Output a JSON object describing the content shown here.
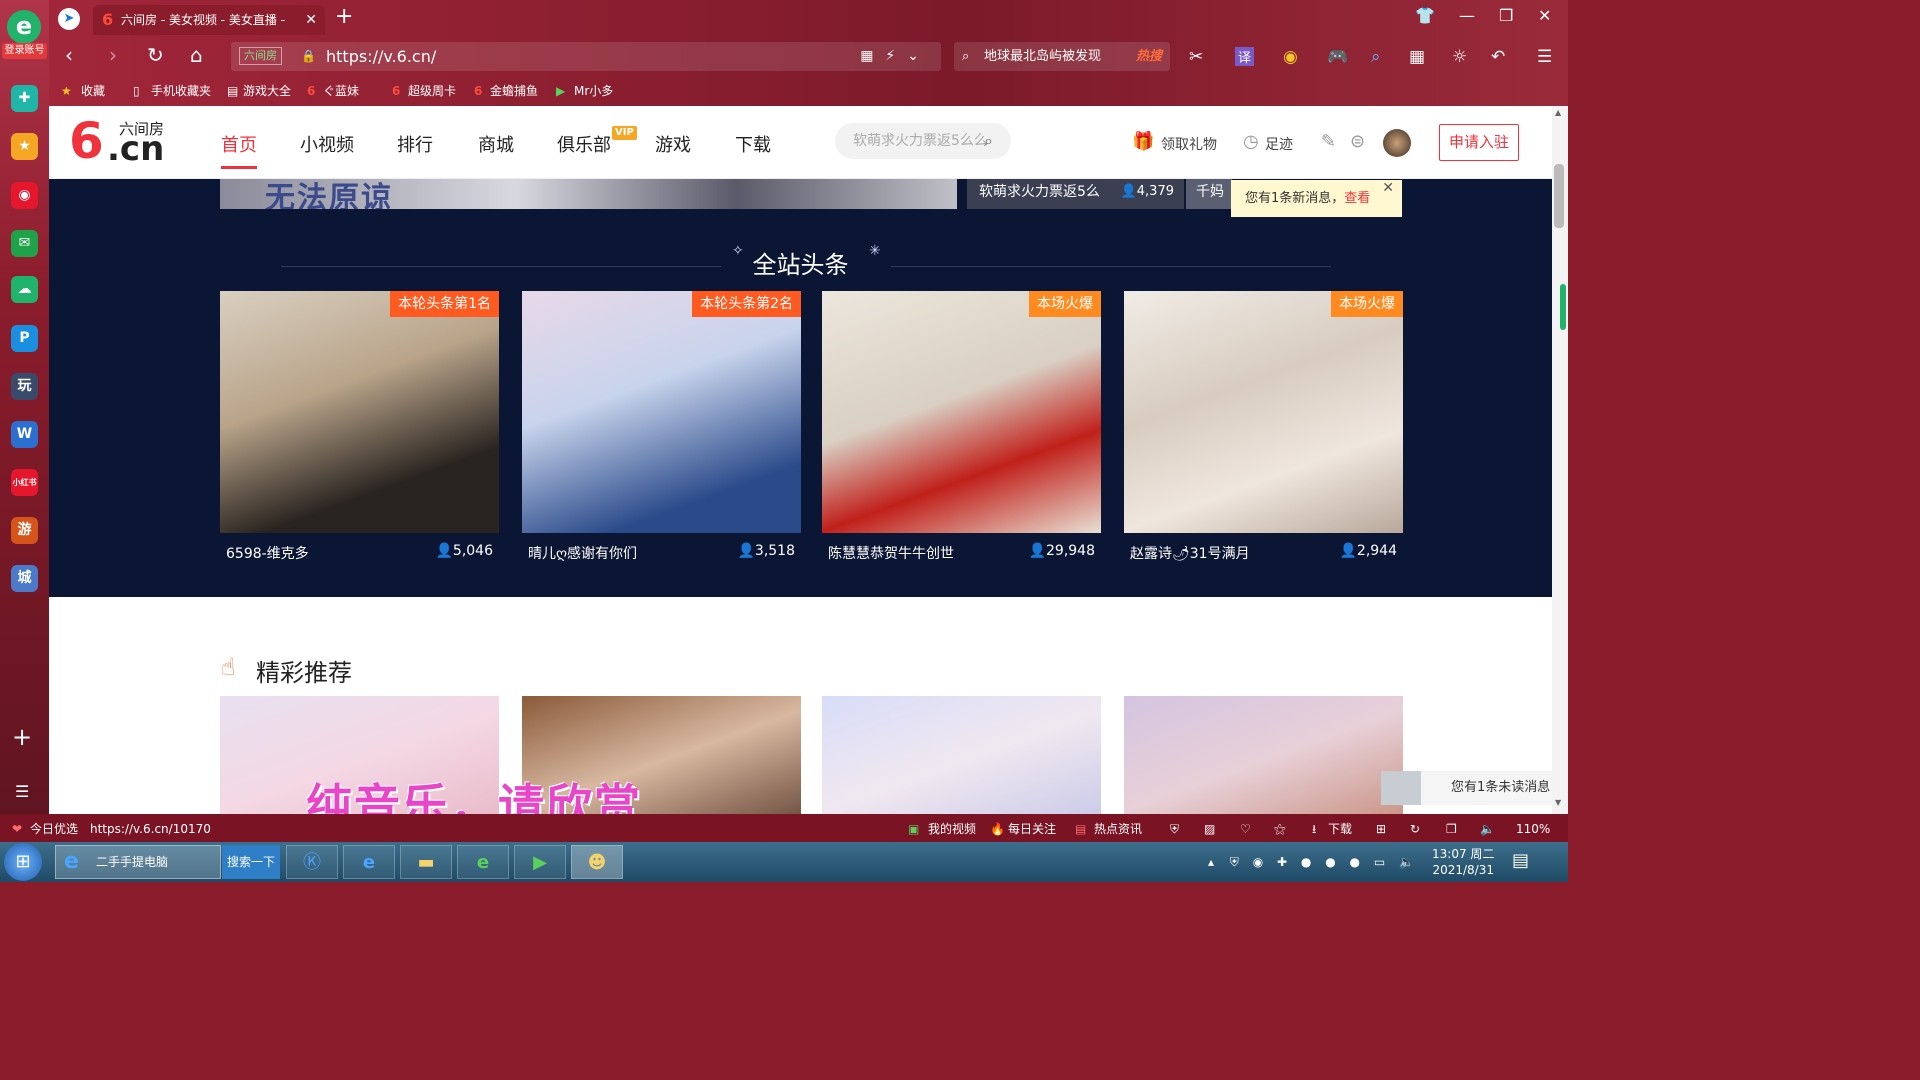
{
  "rail": {
    "login_label": "登录账号",
    "apps": [
      {
        "icon": "app-green-cross-icon",
        "glyph": "✚",
        "color": "#1fb6a8"
      },
      {
        "icon": "star-icon",
        "glyph": "★",
        "color": "#f5a623"
      },
      {
        "icon": "weibo-icon",
        "glyph": "◉",
        "color": "#e6162d"
      },
      {
        "icon": "mail-icon",
        "glyph": "✉",
        "color": "#1fa34a"
      },
      {
        "icon": "cloud-icon",
        "glyph": "☁",
        "color": "#1fb36b"
      },
      {
        "icon": "p-app-icon",
        "glyph": "P",
        "color": "#1a8fe0"
      },
      {
        "icon": "game-app-icon",
        "glyph": "玩",
        "color": "#3a4a6a"
      },
      {
        "icon": "word-doc-icon",
        "glyph": "W",
        "color": "#2b6fd1"
      },
      {
        "icon": "xiaohongshu-icon",
        "glyph": "小红书",
        "color": "#e6162d"
      },
      {
        "icon": "red-game-icon",
        "glyph": "游",
        "color": "#d4541a"
      },
      {
        "icon": "city-game-icon",
        "glyph": "城",
        "color": "#4a7ac8"
      }
    ]
  },
  "browser": {
    "tab_title": "六间房 - 美女视频 - 美女直播 -",
    "url_tag": "六间房",
    "url": "https://v.6.cn/",
    "search_text": "地球最北岛屿被发现",
    "search_hot": "热搜",
    "bookmarks": [
      "收藏",
      "手机收藏夹",
      "游戏大全",
      "ぐ蓝妹",
      "超级周卡",
      "金蟾捕鱼",
      "Mr小多"
    ]
  },
  "site": {
    "logo_small": "六间房",
    "logo_cn": ".cn",
    "nav": [
      "首页",
      "小视频",
      "排行",
      "商城",
      "俱乐部",
      "游戏",
      "下载"
    ],
    "vip_badge": "VIP",
    "search_placeholder": "软萌求火力票返5么么",
    "gift_label": "领取礼物",
    "footprint_label": "足迹",
    "apply_label": "申请入驻",
    "banner_text": "无法原谅",
    "side_card": {
      "name": "软萌求火力票返5么",
      "count": "4,379"
    },
    "side_card2": "千妈",
    "toast": {
      "text": "您有1条新消息，",
      "link": "查看"
    },
    "headline_title": "全站头条",
    "headline_cards": [
      {
        "badge": "本轮头条第1名",
        "badge_color": "#ff5a1f",
        "name": "6598-维克多",
        "count": "5,046",
        "img": "linear-gradient(160deg,#d9cfc0,#b9a48a 40%,#2a2420 75%)"
      },
      {
        "badge": "本轮头条第2名",
        "badge_color": "#ff5a1f",
        "name": "晴儿ღ感谢有你们",
        "count": "3,518",
        "img": "linear-gradient(160deg,#e8d8e8,#c8d4ec 40%,#2a4a8a 80%)"
      },
      {
        "badge": "本场火爆",
        "badge_color": "#ff8a1f",
        "name": "陈慧慧恭贺牛牛创世",
        "count": "29,948",
        "img": "linear-gradient(160deg,#ece6dc,#d9cfc3 45%,#c0201a 70%,#e8e0d4)"
      },
      {
        "badge": "本场火爆",
        "badge_color": "#ff8a1f",
        "name": "赵露诗🌶31号满月",
        "count": "2,944",
        "img": "linear-gradient(160deg,#f0ece6,#d8ccc0 40%,#efe6de 70%,#b8a89a)"
      }
    ],
    "rec_title": "精彩推荐",
    "rec_cards": [
      "linear-gradient(160deg,#e8e0f0,#f4d8e4 50%,#e8b8c8)",
      "linear-gradient(160deg,#8a5a3a,#d8b8a0 50%,#6a4a3a)",
      "linear-gradient(160deg,#d8dcf8,#f0e8f0 50%,#c8c8e8)",
      "linear-gradient(160deg,#d4c4e0,#e8d0d8 50%,#c89080)"
    ],
    "lyric": "纯音乐，请欣赏",
    "unread": "您有1条未读消息"
  },
  "status": {
    "today": "今日优选",
    "url": "https://v.6.cn/10170",
    "items": [
      "我的视频",
      "每日关注",
      "热点资讯",
      "下载"
    ],
    "zoom": "110%"
  },
  "taskbar": {
    "ie_window": "二手手提电脑",
    "search_btn": "搜索一下",
    "time": "13:07 周二",
    "date": "2021/8/31"
  }
}
